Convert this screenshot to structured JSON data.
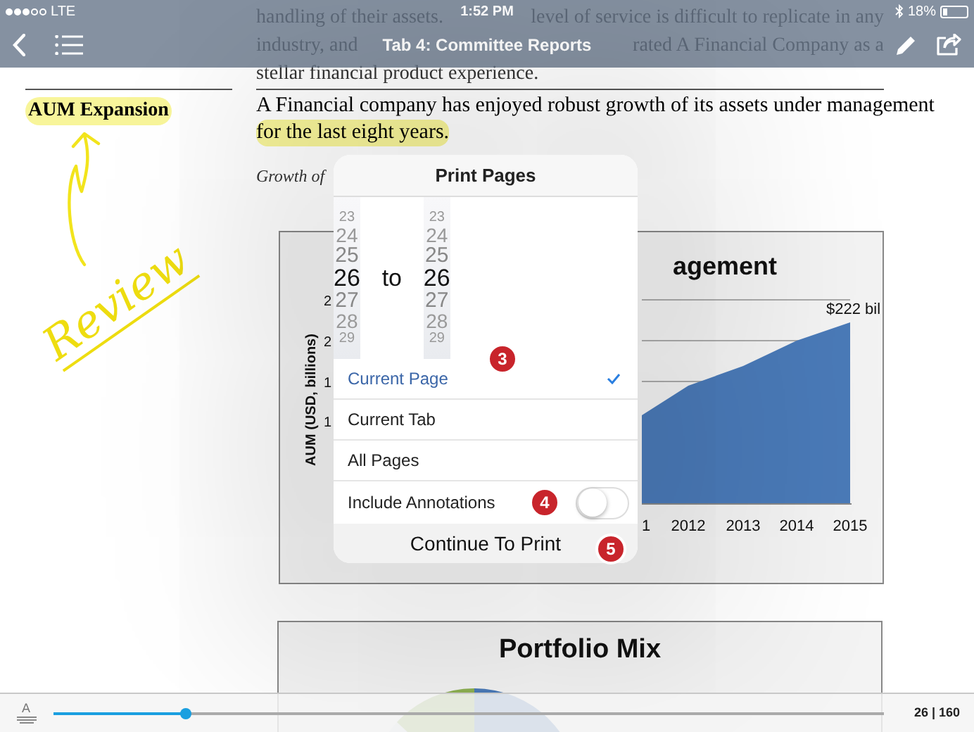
{
  "status_bar": {
    "carrier": "LTE",
    "time": "1:52 PM",
    "battery": "18%"
  },
  "nav_bar": {
    "title": "Tab 4: Committee Reports"
  },
  "document": {
    "intro_lines": [
      {
        "parts": [
          "handling of their assets.",
          "level of service is difficult to replicate in any"
        ]
      },
      {
        "parts": [
          "industry, and",
          "rated A Financial Company as a"
        ]
      },
      {
        "parts": [
          "stellar financial product experience."
        ]
      }
    ],
    "sidebar_heading": {
      "text": "AUM Expansion",
      "highlighted": true
    },
    "annotation": {
      "text": "Review"
    },
    "body_lines": [
      {
        "text": "A Financial company has enjoyed robust growth of its assets under management",
        "highlighted": false
      },
      {
        "text": "for the last eight years.",
        "highlighted": true
      }
    ],
    "caption": "Growth of",
    "growth_chart": {
      "title": "agement",
      "ylabel": "AUM (USD, billions)",
      "y_tick_fragments": [
        "2",
        "2",
        "1",
        "1"
      ],
      "x_labels": [
        "1",
        "2012",
        "2013",
        "2014",
        "2015"
      ],
      "end_label": "$222 bil"
    },
    "mix_chart": {
      "title": "Portfolio Mix"
    }
  },
  "print_dialog": {
    "title": "Print Pages",
    "from_picker": [
      {
        "value": "23",
        "selected": false
      },
      {
        "value": "24",
        "selected": false
      },
      {
        "value": "25",
        "selected": false
      },
      {
        "value": "26",
        "selected": true
      },
      {
        "value": "27",
        "selected": false
      },
      {
        "value": "28",
        "selected": false
      },
      {
        "value": "29",
        "selected": false
      }
    ],
    "separator": "to",
    "to_picker": [
      {
        "value": "23",
        "selected": false
      },
      {
        "value": "24",
        "selected": false
      },
      {
        "value": "25",
        "selected": false
      },
      {
        "value": "26",
        "selected": true
      },
      {
        "value": "27",
        "selected": false
      },
      {
        "value": "28",
        "selected": false
      },
      {
        "value": "29",
        "selected": false
      }
    ],
    "options": [
      {
        "label": "Current Page",
        "selected": true
      },
      {
        "label": "Current Tab",
        "selected": false
      },
      {
        "label": "All Pages",
        "selected": false
      }
    ],
    "include_annotations": {
      "label": "Include Annotations",
      "on": false
    },
    "continue_button": "Continue To Print"
  },
  "callouts": [
    "3",
    "4",
    "5"
  ],
  "bottom_bar": {
    "font_icon_letter": "A",
    "page_slider": {
      "level": 0.16
    },
    "page_counter": "26 | 160"
  }
}
